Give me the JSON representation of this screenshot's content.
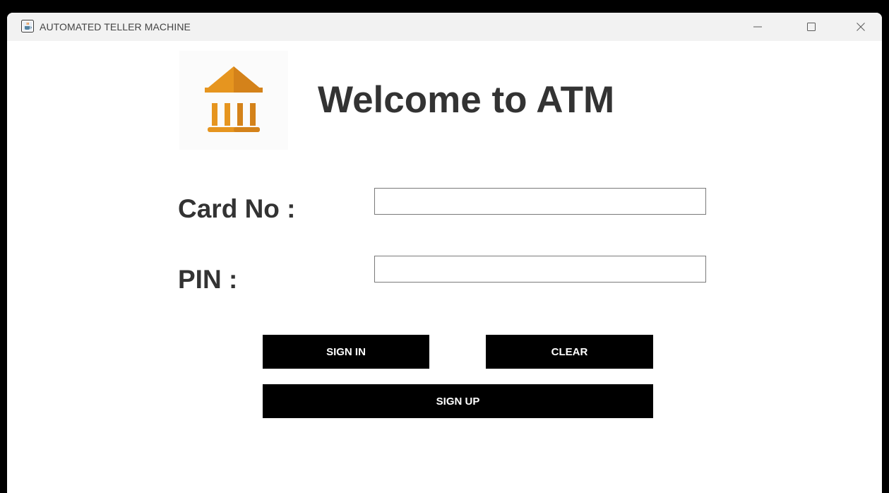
{
  "window": {
    "title": "AUTOMATED TELLER MACHINE",
    "app_icon": "java-cup-icon",
    "controls": [
      "minimize-icon",
      "maximize-icon",
      "close-icon"
    ]
  },
  "logo": {
    "icon": "bank-icon",
    "colors": {
      "roof": "#e6951f",
      "columns": "#e6951f",
      "base": "#d9861b"
    }
  },
  "heading": "Welcome to ATM",
  "form": {
    "card_label": "Card No :",
    "card_value": "",
    "pin_label": "PIN :",
    "pin_value": ""
  },
  "buttons": {
    "sign_in": "SIGN IN",
    "clear": "CLEAR",
    "sign_up": "SIGN UP"
  },
  "colors": {
    "button_bg": "#000000",
    "button_text": "#ffffff",
    "label_text": "#333333"
  }
}
